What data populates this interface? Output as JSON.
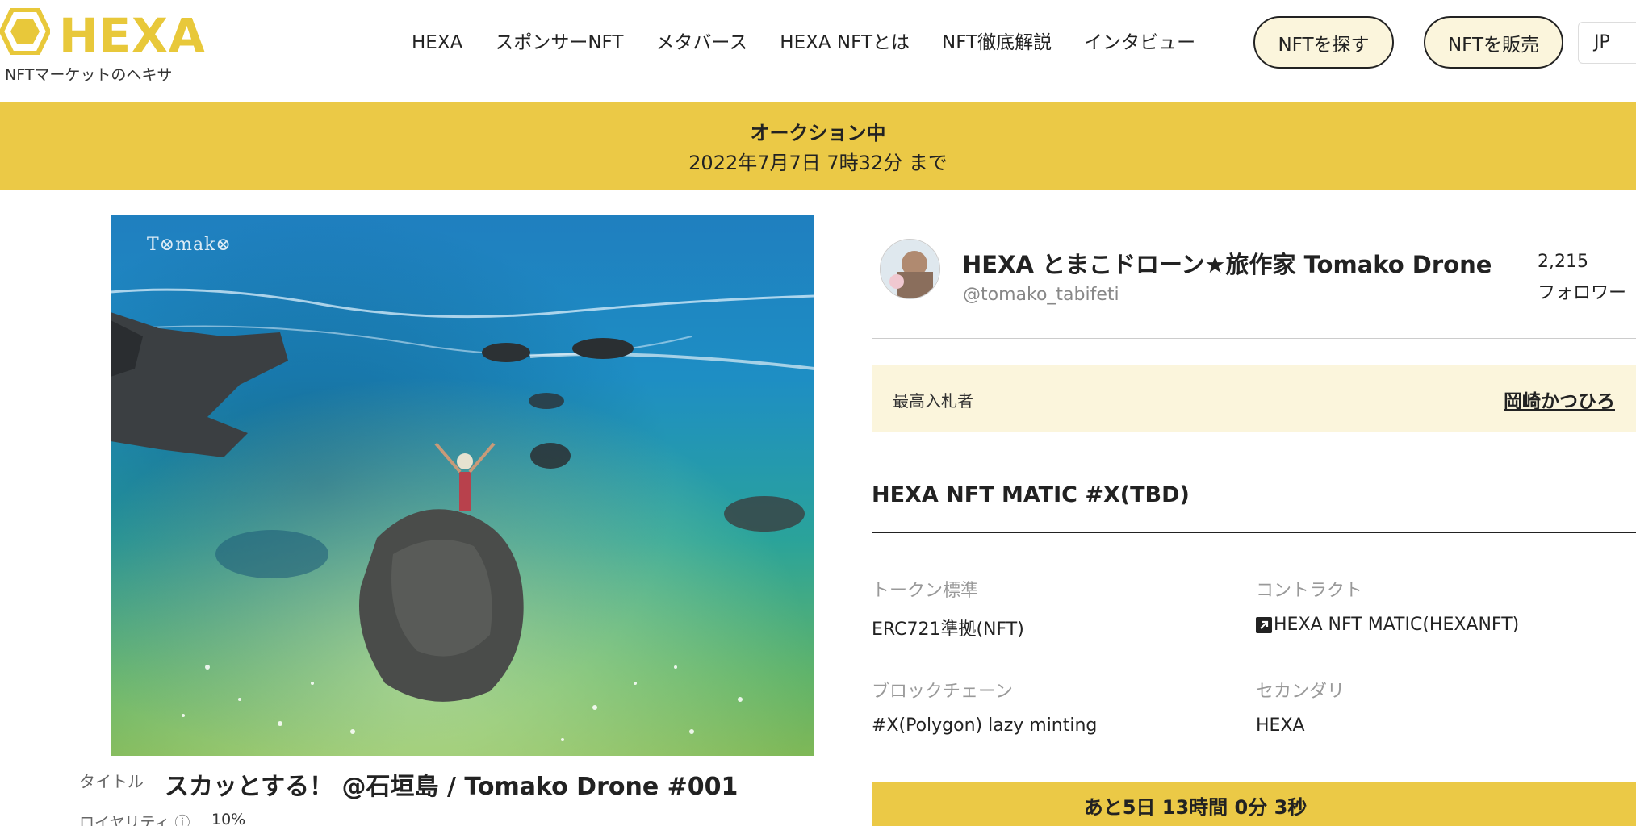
{
  "header": {
    "logo_text": "HEXA",
    "logo_sub": "NFTマーケットのヘキサ",
    "nav": [
      "HEXA",
      "スポンサーNFT",
      "メタバース",
      "HEXA NFTとは",
      "NFT徹底解説",
      "インタビュー"
    ],
    "find_button": "NFTを探す",
    "sell_button": "NFTを販売",
    "language": "JP"
  },
  "banner": {
    "status": "オークション中",
    "until": "2022年7月7日 7時32分 まで"
  },
  "artwork": {
    "watermark": "T⊗mak⊗",
    "title_label": "タイトル",
    "title": "スカッとする！ @石垣島 / Tomako Drone #001",
    "royalty_label": "ロイヤリティ ⓘ",
    "royalty_value": "10%"
  },
  "creator": {
    "name": "HEXA とまこドローン★旅作家 Tomako Drone",
    "handle": "@tomako_tabifeti",
    "followers_count": "2,215",
    "followers_label": "フォロワー"
  },
  "bid": {
    "label": "最高入札者",
    "bidder": "岡崎かつひろ"
  },
  "nft": {
    "heading": "HEXA NFT MATIC #X(TBD)",
    "token_standard_label": "トークン標準",
    "token_standard": "ERC721準拠(NFT)",
    "contract_label": "コントラクト",
    "contract": "HEXA NFT MATIC(HEXANFT)",
    "blockchain_label": "ブロックチェーン",
    "blockchain": "#X(Polygon) lazy minting",
    "secondary_label": "セカンダリ",
    "secondary": "HEXA"
  },
  "countdown": "あと5日 13時間 0分 3秒",
  "colors": {
    "brand_yellow": "#ebc946",
    "cream": "#fbf5dc"
  }
}
